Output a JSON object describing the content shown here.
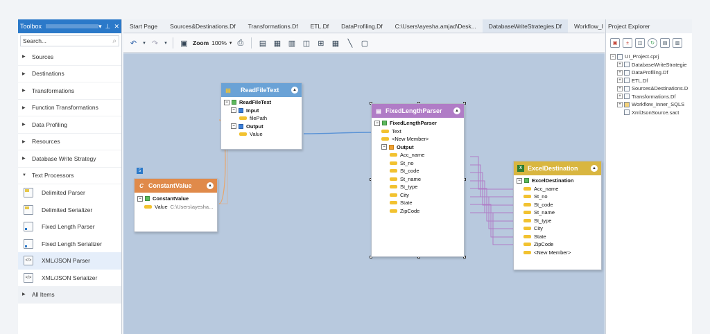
{
  "toolbox": {
    "title": "Toolbox",
    "pin_icon": "pin-icon",
    "search_placeholder": "Search...",
    "categories": [
      {
        "label": "Sources"
      },
      {
        "label": "Destinations"
      },
      {
        "label": "Transformations"
      },
      {
        "label": "Function Transformations"
      },
      {
        "label": "Data Profiling"
      },
      {
        "label": "Resources"
      },
      {
        "label": "Database Write Strategy"
      },
      {
        "label": "Text Processors"
      }
    ],
    "text_processors": [
      {
        "label": "Delimited Parser"
      },
      {
        "label": "Delimited Serializer"
      },
      {
        "label": "Fixed Length Parser"
      },
      {
        "label": "Fixed Length Serializer"
      },
      {
        "label": "XML/JSON Parser"
      },
      {
        "label": "XML/JSON Serializer"
      }
    ],
    "all_items": "All Items"
  },
  "tabs": [
    {
      "label": "Start Page"
    },
    {
      "label": "Sources&Destinations.Df"
    },
    {
      "label": "Transformations.Df"
    },
    {
      "label": "ETL.Df"
    },
    {
      "label": "DataProfiling.Df"
    },
    {
      "label": "C:\\Users\\ayesha.amjad\\Desk..."
    },
    {
      "label": "DatabaseWriteStrategies.Df"
    },
    {
      "label": "Workflow_I"
    }
  ],
  "toolbar": {
    "zoom_label": "Zoom",
    "zoom_value": "100%"
  },
  "nodes": {
    "readfile": {
      "title": "ReadFileText",
      "root": "ReadFileText",
      "input": "Input",
      "filepath": "filePath",
      "output": "Output",
      "value": "Value"
    },
    "constant": {
      "title": "ConstantValue",
      "root": "ConstantValue",
      "value_label": "Value",
      "value_text": "C:\\Users\\ayesha...",
      "badge": "5"
    },
    "fixed": {
      "title": "FixedLengthParser",
      "root": "FixedLengthParser",
      "text": "Text",
      "new_member": "<New Member>",
      "output": "Output",
      "fields": [
        "Acc_name",
        "St_no",
        "St_code",
        "St_name",
        "St_type",
        "City",
        "State",
        "ZipCode"
      ]
    },
    "excel": {
      "title": "ExcelDestination",
      "root": "ExcelDestination",
      "fields": [
        "Acc_name",
        "St_no",
        "St_code",
        "St_name",
        "St_type",
        "City",
        "State",
        "ZipCode",
        "<New Member>"
      ]
    }
  },
  "project": {
    "title": "Project Explorer",
    "items": [
      {
        "label": "UI_Project.cprj"
      },
      {
        "label": "DatabaseWriteStrategie"
      },
      {
        "label": "DataProfiling.Df"
      },
      {
        "label": "ETL.Df"
      },
      {
        "label": "Sources&Destinations.D"
      },
      {
        "label": "Transformations.Df"
      },
      {
        "label": "Workflow_Inner_SQLS"
      },
      {
        "label": "XmlJsonSource.sact"
      }
    ]
  },
  "colors": {
    "accent": "#2b79c9",
    "canvas": "#b8c9de",
    "readfile_header": "#6aa2d6",
    "constant_header": "#e08a4a",
    "fixed_header": "#b07cc6",
    "excel_header": "#d9b640"
  }
}
